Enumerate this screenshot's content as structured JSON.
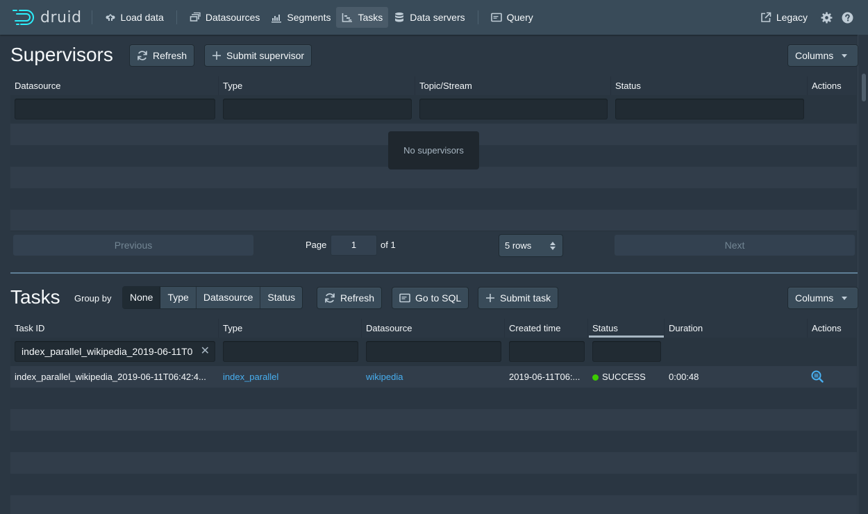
{
  "nav": {
    "brand": "druid",
    "items": [
      {
        "label": "Load data",
        "icon": "cloud-upload-icon"
      },
      {
        "label": "Datasources",
        "icon": "multi-select-icon"
      },
      {
        "label": "Segments",
        "icon": "stacked-chart-icon"
      },
      {
        "label": "Tasks",
        "icon": "gantt-chart-icon",
        "active": true
      },
      {
        "label": "Data servers",
        "icon": "database-icon"
      },
      {
        "label": "Query",
        "icon": "application-icon"
      }
    ],
    "legacy": "Legacy",
    "settings_icon": "gear-icon",
    "help_icon": "help-icon"
  },
  "supervisors": {
    "title": "Supervisors",
    "refresh": "Refresh",
    "submit": "Submit supervisor",
    "columns_btn": "Columns",
    "headers": [
      "Datasource",
      "Type",
      "Topic/Stream",
      "Status",
      "Actions"
    ],
    "filters": [
      "",
      "",
      "",
      ""
    ],
    "no_data": "No supervisors",
    "pagination": {
      "previous": "Previous",
      "page_label": "Page",
      "page": "1",
      "of": "of 1",
      "rows": "5 rows",
      "next": "Next"
    }
  },
  "tasks": {
    "title": "Tasks",
    "group_by_label": "Group by",
    "group_by": [
      {
        "label": "None",
        "active": true
      },
      {
        "label": "Type"
      },
      {
        "label": "Datasource"
      },
      {
        "label": "Status"
      }
    ],
    "refresh": "Refresh",
    "go_to_sql": "Go to SQL",
    "submit": "Submit task",
    "columns_btn": "Columns",
    "headers": [
      "Task ID",
      "Type",
      "Datasource",
      "Created time",
      "Status",
      "Duration",
      "Actions"
    ],
    "sorted_column": "Status",
    "filters": {
      "task_id": "index_parallel_wikipedia_2019-06-11T0",
      "type": "",
      "datasource": "",
      "created_time": "",
      "status": ""
    },
    "rows": [
      {
        "task_id": "index_parallel_wikipedia_2019-06-11T06:42:4...",
        "type": "index_parallel",
        "datasource": "wikipedia",
        "created_time": "2019-06-11T06:...",
        "status": "SUCCESS",
        "status_color": "#3dcc00",
        "duration": "0:00:48",
        "action_icon": "search-template-icon"
      }
    ]
  },
  "colors": {
    "link": "#48aff0",
    "success": "#3dcc00",
    "logo_accent": "#2ceefb"
  }
}
